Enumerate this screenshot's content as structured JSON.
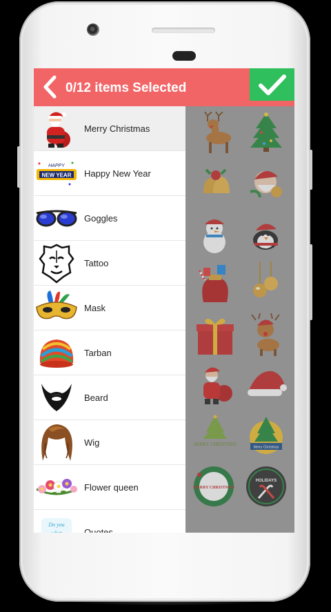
{
  "header": {
    "title": "0/12 items Selected",
    "back_icon": "chevron-left-icon",
    "confirm_icon": "checkmark-icon"
  },
  "categories": [
    {
      "label": "Merry Christmas",
      "icon": "santa-icon",
      "selected": true
    },
    {
      "label": "Happy New Year",
      "icon": "new-year-banner-icon",
      "selected": false
    },
    {
      "label": "Goggles",
      "icon": "goggles-icon",
      "selected": false
    },
    {
      "label": "Tattoo",
      "icon": "lion-tattoo-icon",
      "selected": false
    },
    {
      "label": "Mask",
      "icon": "carnival-mask-icon",
      "selected": false
    },
    {
      "label": "Tarban",
      "icon": "turban-icon",
      "selected": false
    },
    {
      "label": "Beard",
      "icon": "beard-icon",
      "selected": false
    },
    {
      "label": "Wig",
      "icon": "wig-icon",
      "selected": false
    },
    {
      "label": "Flower queen",
      "icon": "flower-crown-icon",
      "selected": false
    },
    {
      "label": "Quotes",
      "icon": "quote-icon",
      "selected": false
    }
  ],
  "stickers": [
    {
      "name": "reindeer-sticker"
    },
    {
      "name": "christmas-tree-sticker"
    },
    {
      "name": "bells-sticker"
    },
    {
      "name": "santa-bells-sticker"
    },
    {
      "name": "snowman-sticker"
    },
    {
      "name": "penguin-sticker"
    },
    {
      "name": "gift-sack-sticker"
    },
    {
      "name": "ornaments-sticker"
    },
    {
      "name": "gift-box-sticker"
    },
    {
      "name": "reindeer-hat-sticker"
    },
    {
      "name": "santa-sack-sticker"
    },
    {
      "name": "santa-hat-sticker"
    },
    {
      "name": "merry-christmas-tree-text-sticker",
      "text": "MERRY CHRISTMAS"
    },
    {
      "name": "tree-badge-sticker",
      "text": "Merry Christmas"
    },
    {
      "name": "merry-christmas-wreath-sticker",
      "text": "MERRY CHRISTMAS"
    },
    {
      "name": "holiday-candy-cane-badge-sticker",
      "text": "HOLIDAYS"
    }
  ],
  "colors": {
    "header": "#f26567",
    "confirm": "#2fbf5c",
    "selected_row": "#efefef"
  }
}
